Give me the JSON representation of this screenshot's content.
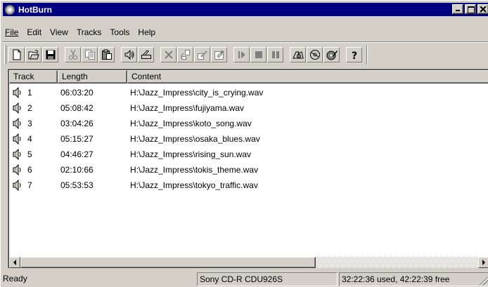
{
  "window": {
    "title": "HotBurn"
  },
  "menu": [
    {
      "label": "File"
    },
    {
      "label": "Edit"
    },
    {
      "label": "View"
    },
    {
      "label": "Tracks"
    },
    {
      "label": "Tools"
    },
    {
      "label": "Help"
    }
  ],
  "toolbar": {
    "buttons": [
      "new-icon",
      "open-icon",
      "save-icon",
      "cut-icon",
      "copy-icon",
      "paste-icon",
      "add-track-icon",
      "record-icon",
      "delete-icon",
      "move-icon",
      "edit-icon",
      "properties-icon",
      "play-icon",
      "stop-icon",
      "pause-icon",
      "burn-icon",
      "disc-icon",
      "disc-write-icon",
      "help-icon"
    ]
  },
  "columns": {
    "track": "Track",
    "length": "Length",
    "content": "Content"
  },
  "tracks": [
    {
      "num": "1",
      "length": "06:03:20",
      "content": "H:\\Jazz_Impress\\city_is_crying.wav"
    },
    {
      "num": "2",
      "length": "05:08:42",
      "content": "H:\\Jazz_Impress\\fujiyama.wav"
    },
    {
      "num": "3",
      "length": "03:04:26",
      "content": "H:\\Jazz_Impress\\koto_song.wav"
    },
    {
      "num": "4",
      "length": "05:15:27",
      "content": "H:\\Jazz_Impress\\osaka_blues.wav"
    },
    {
      "num": "5",
      "length": "04:46:27",
      "content": "H:\\Jazz_Impress\\rising_sun.wav"
    },
    {
      "num": "6",
      "length": "02:10:66",
      "content": "H:\\Jazz_Impress\\tokis_theme.wav"
    },
    {
      "num": "7",
      "length": "05:53:53",
      "content": "H:\\Jazz_Impress\\tokyo_traffic.wav"
    }
  ],
  "status": {
    "state": "Ready",
    "device": "Sony CD-R CDU926S",
    "usage": "32:22:36 used, 42:22:39 free"
  },
  "colors": {
    "titlebar": "#000080",
    "face": "#d4d0c8"
  }
}
